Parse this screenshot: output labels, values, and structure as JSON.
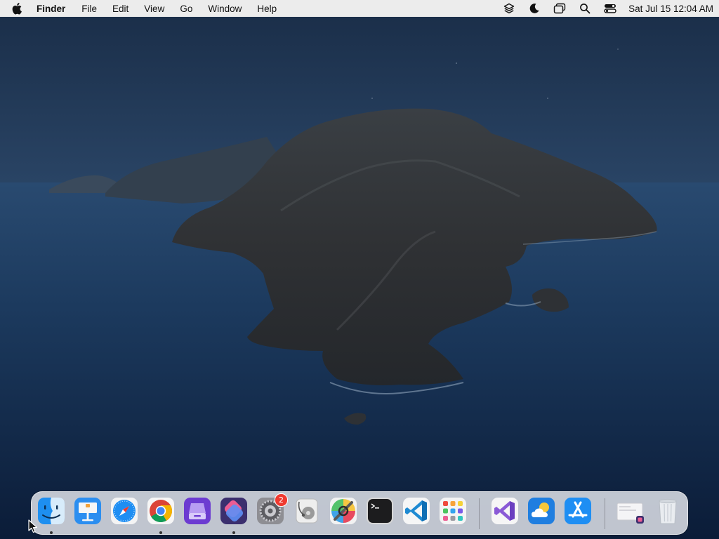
{
  "menubar": {
    "app_name": "Finder",
    "menus": [
      "File",
      "Edit",
      "View",
      "Go",
      "Window",
      "Help"
    ],
    "status_icons": [
      "layers-icon",
      "moon-icon",
      "windows-icon",
      "search-icon",
      "control-center-icon"
    ],
    "clock": "Sat Jul 15  12:04 AM"
  },
  "dock": {
    "apps": [
      {
        "name": "Finder",
        "icon": "finder-icon",
        "running": true
      },
      {
        "name": "Keynote",
        "icon": "keynote-icon",
        "running": false
      },
      {
        "name": "Safari",
        "icon": "safari-icon",
        "running": false
      },
      {
        "name": "Google Chrome",
        "icon": "chrome-icon",
        "running": true
      },
      {
        "name": "Archive Utility",
        "icon": "archive-icon",
        "running": false
      },
      {
        "name": "Shortcuts",
        "icon": "shortcuts-icon",
        "running": true
      },
      {
        "name": "System Settings",
        "icon": "settings-icon",
        "running": false,
        "badge": "2"
      },
      {
        "name": "Disk Utility",
        "icon": "disk-utility-icon",
        "running": false
      },
      {
        "name": "ColorSync Utility",
        "icon": "colorsync-icon",
        "running": false
      },
      {
        "name": "Terminal",
        "icon": "terminal-icon",
        "running": false
      },
      {
        "name": "Visual Studio Code",
        "icon": "vscode-icon",
        "running": false
      },
      {
        "name": "Launchpad",
        "icon": "launchpad-icon",
        "running": false
      },
      {
        "name": "Visual Studio",
        "icon": "visual-studio-icon",
        "running": false
      },
      {
        "name": "Weather",
        "icon": "weather-icon",
        "running": false
      },
      {
        "name": "App Store",
        "icon": "app-store-icon",
        "running": false
      },
      {
        "name": "Downloads",
        "icon": "downloads-stack-icon",
        "running": false
      },
      {
        "name": "Trash",
        "icon": "trash-icon",
        "running": false
      }
    ]
  },
  "colors": {
    "menubar_bg": "#ececec",
    "dock_bg": "#e8eaf0",
    "badge": "#ef3a30",
    "ocean": "#1b3454"
  }
}
